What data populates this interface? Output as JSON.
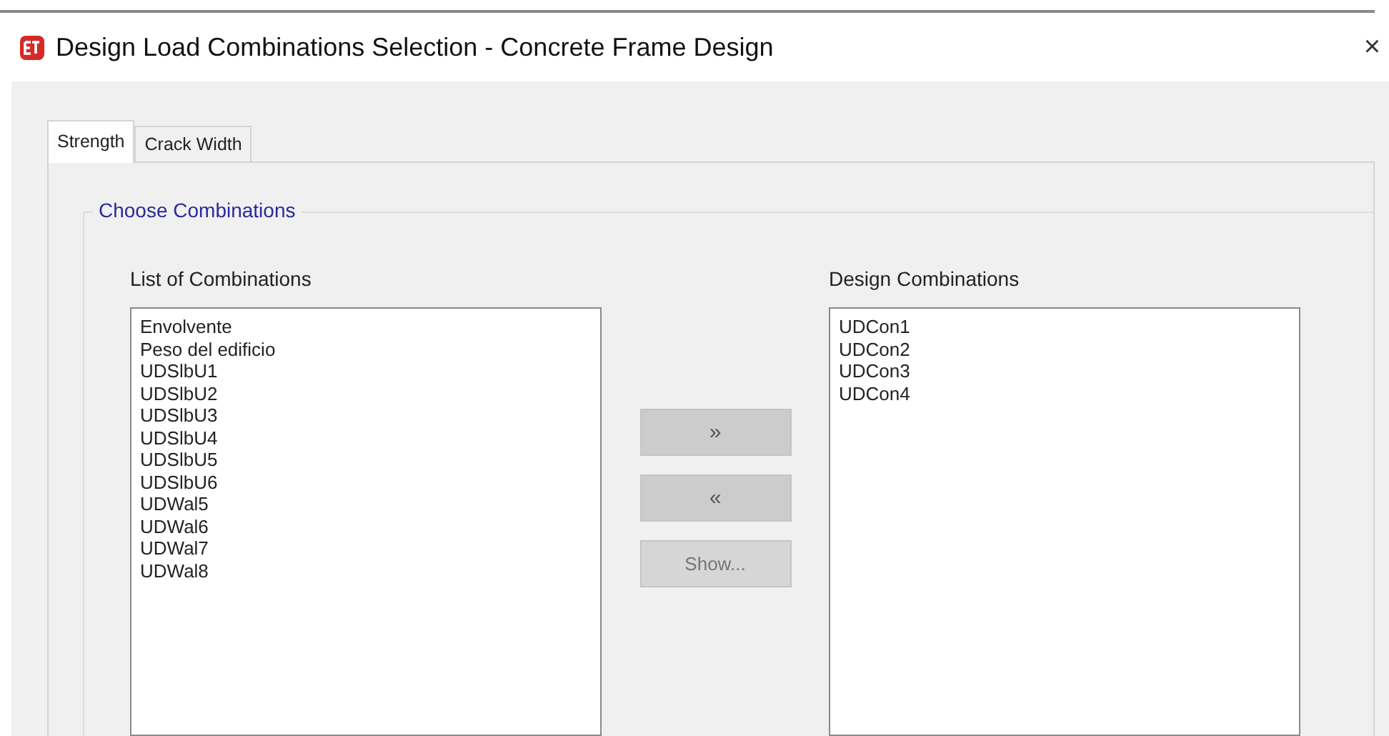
{
  "window": {
    "title": "Design Load Combinations Selection - Concrete Frame Design",
    "close": "×"
  },
  "tabs": [
    {
      "label": "Strength",
      "selected": true
    },
    {
      "label": "Crack Width",
      "selected": false
    }
  ],
  "group": {
    "title": "Choose Combinations"
  },
  "list_of_combinations": {
    "label": "List of Combinations",
    "items": [
      "Envolvente",
      "Peso del edificio",
      "UDSlbU1",
      "UDSlbU2",
      "UDSlbU3",
      "UDSlbU4",
      "UDSlbU5",
      "UDSlbU6",
      "UDWal5",
      "UDWal6",
      "UDWal7",
      "UDWal8"
    ]
  },
  "buttons": [
    {
      "label": "»",
      "disabled": false
    },
    {
      "label": "«",
      "disabled": false
    },
    {
      "label": "Show...",
      "disabled": true
    }
  ],
  "design_combinations": {
    "label": "Design Combinations",
    "items": [
      "UDCon1",
      "UDCon2",
      "UDCon3",
      "UDCon4"
    ]
  }
}
